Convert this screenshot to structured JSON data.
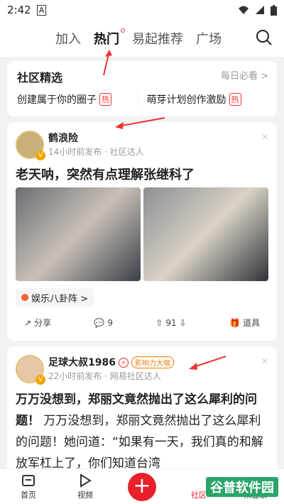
{
  "status": {
    "time": "2:42",
    "notif": "A"
  },
  "nav": {
    "tabs": [
      "加入",
      "热门",
      "易起推荐",
      "广场"
    ]
  },
  "community": {
    "title": "社区精选",
    "more": "每日必看 >",
    "items": [
      {
        "label": "创建属于你的圈子",
        "tag": "热"
      },
      {
        "label": "萌芽计划创作激励",
        "tag": "热"
      }
    ]
  },
  "post1": {
    "author": "鹤浪险",
    "meta": "14小时前发布 · 社区达人",
    "headline": "老天呐，突然有点理解张继科了",
    "topic": "娱乐八卦阵 >",
    "share": "分享",
    "comments": "9",
    "votes": "91",
    "props": "道具"
  },
  "post2": {
    "author": "足球大叔1986",
    "badge": "影响力大咖",
    "meta": "22小时前发布 · 网易社区达人",
    "bold": "万万没想到，郑丽文竟然抛出了这么犀利的问题！",
    "body": "万万没想到，郑丽文竟然抛出了这么犀利的问题！她问道：“如果有一天，我们真的和解放军杠上了，你们知道台湾"
  },
  "bottom": {
    "home": "首页",
    "video": "视频",
    "plus": "+",
    "community": "社区",
    "mine": "未登录"
  },
  "watermark": "谷普软件园",
  "colors": {
    "accent": "#e8202a",
    "arrow": "#e33"
  }
}
